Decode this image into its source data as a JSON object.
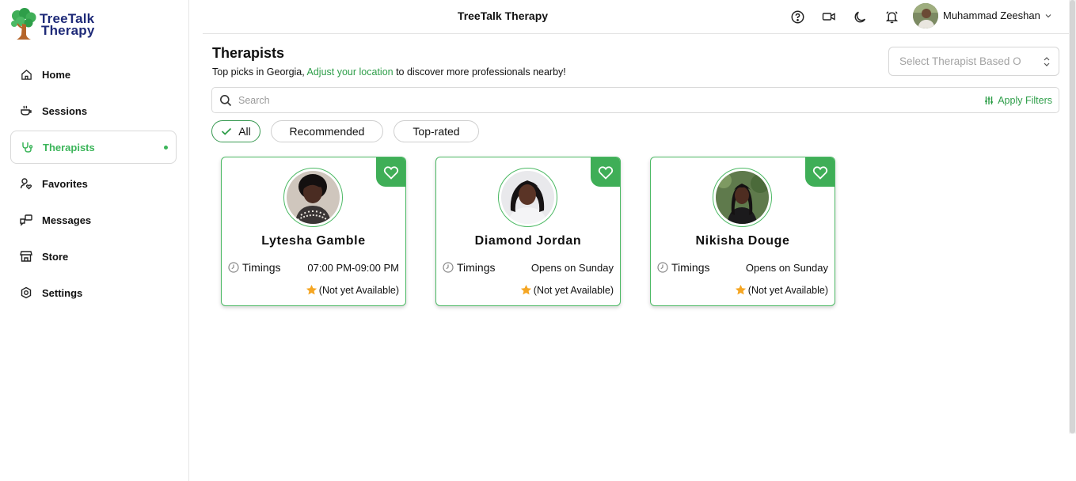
{
  "app": {
    "brand_line1": "TreeTalk",
    "brand_line2": "Therapy",
    "title": "TreeTalk Therapy"
  },
  "sidebar": {
    "items": [
      {
        "label": "Home",
        "icon": "home-icon"
      },
      {
        "label": "Sessions",
        "icon": "coffee-cup-icon"
      },
      {
        "label": "Therapists",
        "icon": "stethoscope-icon",
        "active": true
      },
      {
        "label": "Favorites",
        "icon": "user-heart-icon"
      },
      {
        "label": "Messages",
        "icon": "chat-icon"
      },
      {
        "label": "Store",
        "icon": "store-icon"
      },
      {
        "label": "Settings",
        "icon": "settings-icon"
      }
    ]
  },
  "header": {
    "icons": [
      "help-icon",
      "video-icon",
      "moon-icon",
      "bell-icon"
    ],
    "user_name": "Muhammad Zeeshan"
  },
  "main": {
    "title": "Therapists",
    "subtitle_prefix": "Top picks in Georgia, ",
    "subtitle_link": "Adjust your location",
    "subtitle_suffix": " to discover more professionals nearby!",
    "select_placeholder": "Select Therapist Based O",
    "search_placeholder": "Search",
    "apply_filters_label": "Apply Filters",
    "chips": [
      {
        "label": "All",
        "active": true
      },
      {
        "label": "Recommended",
        "active": false
      },
      {
        "label": "Top-rated",
        "active": false
      }
    ],
    "timings_label": "Timings",
    "therapists": [
      {
        "name": "Lytesha Gamble",
        "time": "07:00 PM-09:00 PM",
        "rating": "(Not yet Available)"
      },
      {
        "name": "Diamond Jordan",
        "time": "Opens on Sunday",
        "rating": "(Not yet Available)"
      },
      {
        "name": "Nikisha Douge",
        "time": "Opens on Sunday",
        "rating": "(Not yet Available)"
      }
    ]
  },
  "colors": {
    "accent": "#3cb55a",
    "link": "#2e9e49",
    "brand_text": "#1e2a78",
    "star": "#f5a623"
  }
}
